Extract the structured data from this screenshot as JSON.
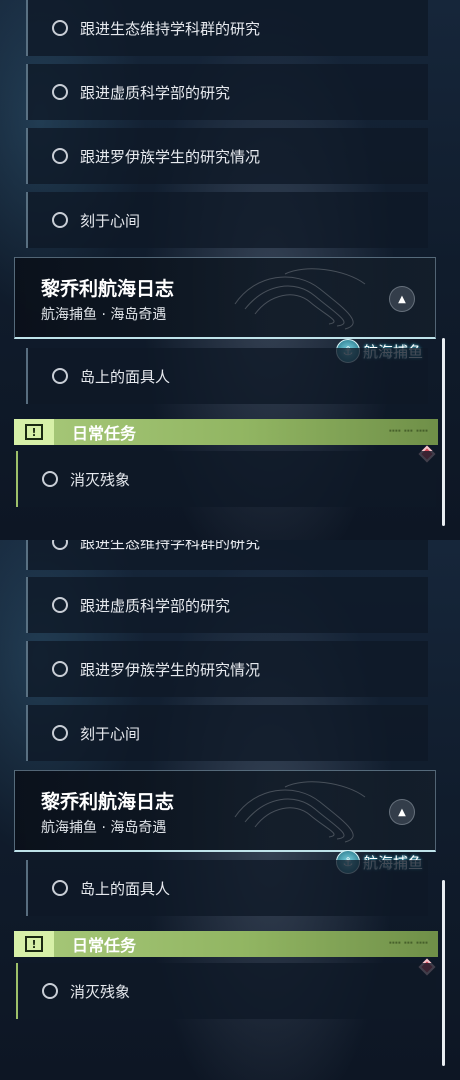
{
  "colors": {
    "daily_accent": "#9dc06a",
    "header_border": "#bfe3ea",
    "event_badge": "#3b8c9e",
    "alert_diamond": "#d64a5a"
  },
  "top": {
    "tasks_before": [
      {
        "label": "跟进生态维持学科群的研究"
      },
      {
        "label": "跟进虚质科学部的研究"
      },
      {
        "label": "跟进罗伊族学生的研究情况"
      },
      {
        "label": "刻于心间"
      }
    ],
    "quest": {
      "title": "黎乔利航海日志",
      "subtitle": "航海捕鱼 · 海岛奇遇",
      "collapse_icon": "chevron-up-icon",
      "badge_icon": "anchor-icon",
      "badge_text": "航海捕鱼"
    },
    "task_after": {
      "label": "岛上的面具人"
    },
    "daily": {
      "icon": "alert-square-icon",
      "label": "日常任务",
      "tasks": [
        {
          "label": "消灭残象"
        }
      ]
    }
  },
  "bottom": {
    "partial_task": {
      "label": "跟进生态维持学科群的研究"
    },
    "tasks_before": [
      {
        "label": "跟进虚质科学部的研究"
      },
      {
        "label": "跟进罗伊族学生的研究情况"
      },
      {
        "label": "刻于心间"
      }
    ],
    "quest": {
      "title": "黎乔利航海日志",
      "subtitle": "航海捕鱼 · 海岛奇遇",
      "collapse_icon": "chevron-up-icon",
      "badge_icon": "anchor-icon",
      "badge_text": "航海捕鱼"
    },
    "task_after": {
      "label": "岛上的面具人"
    },
    "daily": {
      "icon": "alert-square-icon",
      "label": "日常任务",
      "tasks": [
        {
          "label": "消灭残象"
        }
      ]
    }
  }
}
